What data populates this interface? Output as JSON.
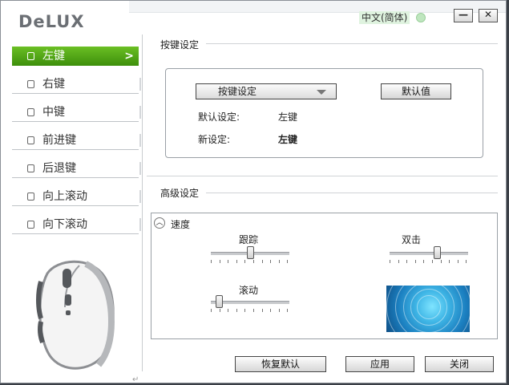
{
  "app": {
    "brand": "DeLUX",
    "language": "中文(简体)"
  },
  "window_controls": {
    "minimize": "—",
    "close": "✕"
  },
  "sidebar": {
    "items": [
      {
        "label": "左键",
        "active": true,
        "arrow": ">"
      },
      {
        "label": "右键"
      },
      {
        "label": "中键"
      },
      {
        "label": "前进键"
      },
      {
        "label": "后退键"
      },
      {
        "label": "向上滚动"
      },
      {
        "label": "向下滚动"
      }
    ]
  },
  "key_settings": {
    "title": "按键设定",
    "dropdown_value": "按键设定",
    "default_button": "默认值",
    "default_label": "默认设定:",
    "default_value": "左键",
    "new_label": "新设定:",
    "new_value": "左键"
  },
  "advanced": {
    "title": "高级设定",
    "speed_label": "速度",
    "track_label": "跟踪",
    "double_click_label": "双击",
    "scroll_label": "滚动",
    "levels": {
      "track": 0.5,
      "double_click": 0.6,
      "scroll": 0.1
    }
  },
  "footer": {
    "restore_label": "恢复默认",
    "apply_label": "应用",
    "close_label": "关闭"
  },
  "colors": {
    "accent": "#4fa312",
    "preview": "#1b7fc0"
  }
}
